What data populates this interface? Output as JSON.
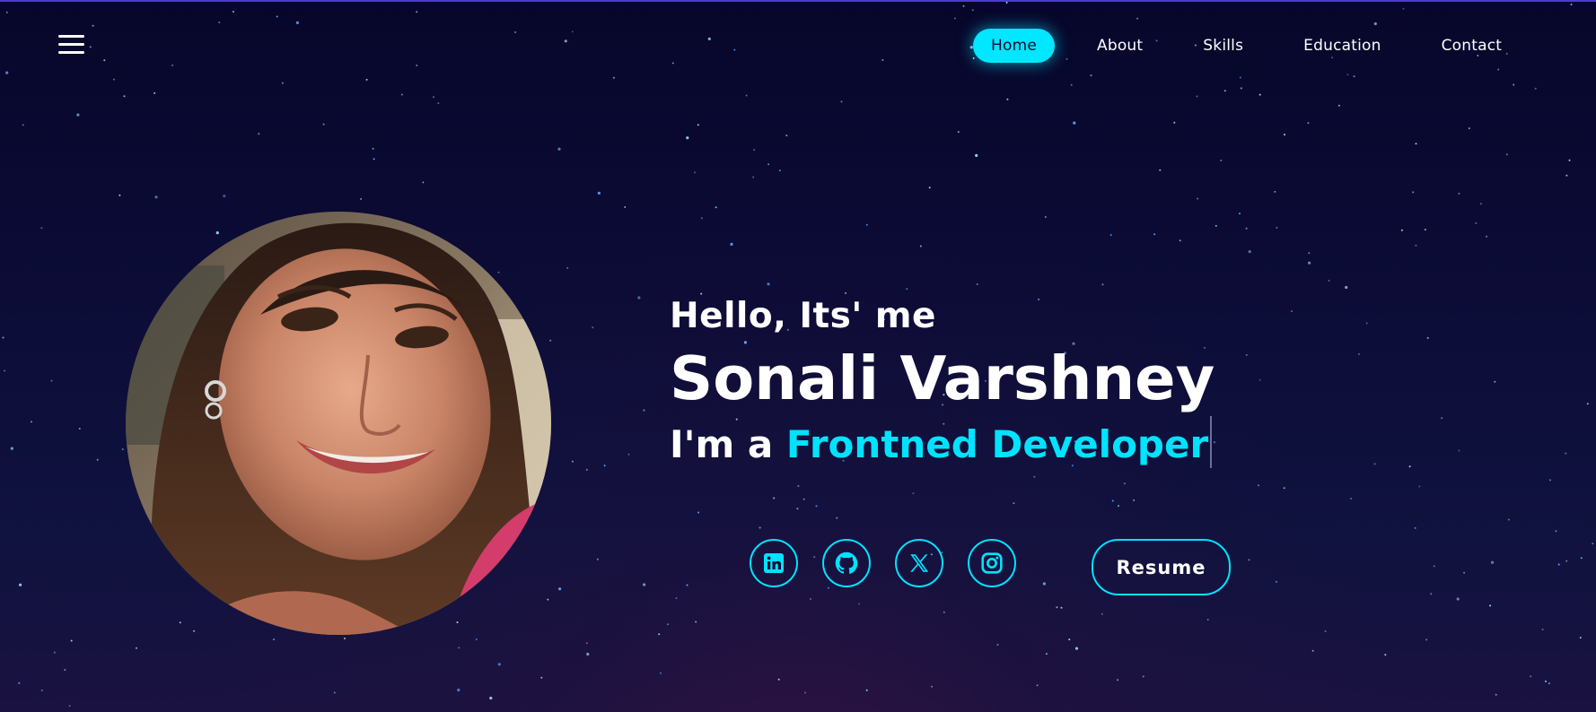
{
  "theme": {
    "accent": "#00e3ff",
    "background": "#0b0b35",
    "text": "#ffffff"
  },
  "header": {
    "menu_icon": "hamburger-menu-icon",
    "nav": [
      {
        "label": "Home",
        "active": true
      },
      {
        "label": "About",
        "active": false
      },
      {
        "label": "Skills",
        "active": false
      },
      {
        "label": "Education",
        "active": false
      },
      {
        "label": "Contact",
        "active": false
      }
    ]
  },
  "hero": {
    "greeting": "Hello, Its' me",
    "name": "Sonali Varshney",
    "role_prefix": "I'm a",
    "role_highlight": "Frontned Developer",
    "profile_photo": "profile-photo"
  },
  "socials": [
    {
      "icon": "linkedin-icon",
      "glyph": "in"
    },
    {
      "icon": "github-icon",
      "glyph": ""
    },
    {
      "icon": "x-twitter-icon",
      "glyph": "X"
    },
    {
      "icon": "instagram-icon",
      "glyph": ""
    }
  ],
  "resume_button": {
    "label": "Resume"
  }
}
